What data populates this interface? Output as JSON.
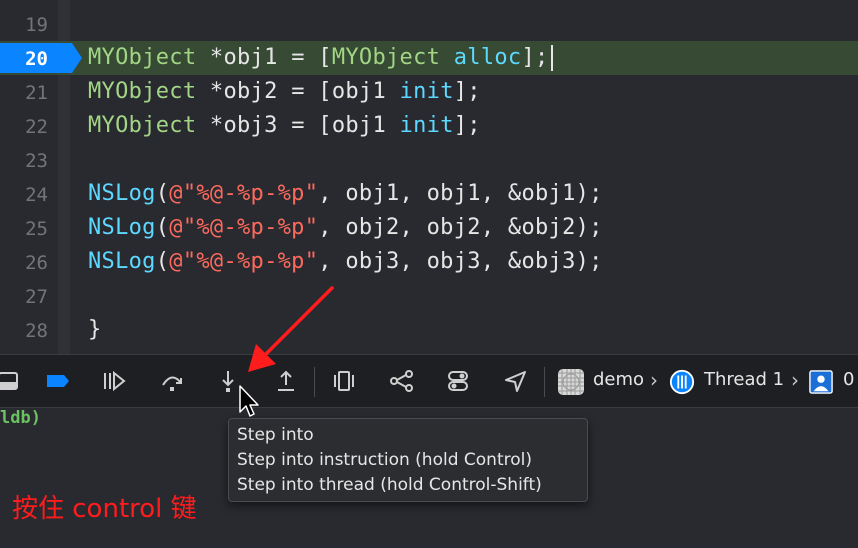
{
  "editor": {
    "lines": [
      {
        "num": "19",
        "tokens": []
      },
      {
        "num": "20",
        "current": true,
        "tokens": [
          {
            "cls": "t-type",
            "text": "MYObject"
          },
          {
            "cls": "t-plain",
            "text": " *obj1 = ["
          },
          {
            "cls": "t-type",
            "text": "MYObject"
          },
          {
            "cls": "t-plain",
            "text": " "
          },
          {
            "cls": "t-msg",
            "text": "alloc"
          },
          {
            "cls": "t-plain",
            "text": "];"
          }
        ]
      },
      {
        "num": "21",
        "tokens": [
          {
            "cls": "t-type",
            "text": "MYObject"
          },
          {
            "cls": "t-plain",
            "text": " *obj2 = [obj1 "
          },
          {
            "cls": "t-msg",
            "text": "init"
          },
          {
            "cls": "t-plain",
            "text": "];"
          }
        ]
      },
      {
        "num": "22",
        "tokens": [
          {
            "cls": "t-type",
            "text": "MYObject"
          },
          {
            "cls": "t-plain",
            "text": " *obj3 = [obj1 "
          },
          {
            "cls": "t-msg",
            "text": "init"
          },
          {
            "cls": "t-plain",
            "text": "];"
          }
        ]
      },
      {
        "num": "23",
        "tokens": []
      },
      {
        "num": "24",
        "tokens": [
          {
            "cls": "t-msg",
            "text": "NSLog"
          },
          {
            "cls": "t-plain",
            "text": "("
          },
          {
            "cls": "t-str",
            "text": "@\"%@-%p-%p\""
          },
          {
            "cls": "t-plain",
            "text": ", obj1, obj1, &obj1);"
          }
        ]
      },
      {
        "num": "25",
        "tokens": [
          {
            "cls": "t-msg",
            "text": "NSLog"
          },
          {
            "cls": "t-plain",
            "text": "("
          },
          {
            "cls": "t-str",
            "text": "@\"%@-%p-%p\""
          },
          {
            "cls": "t-plain",
            "text": ", obj2, obj2, &obj2);"
          }
        ]
      },
      {
        "num": "26",
        "tokens": [
          {
            "cls": "t-msg",
            "text": "NSLog"
          },
          {
            "cls": "t-plain",
            "text": "("
          },
          {
            "cls": "t-str",
            "text": "@\"%@-%p-%p\""
          },
          {
            "cls": "t-plain",
            "text": ", obj3, obj3, &obj3);"
          }
        ]
      },
      {
        "num": "27",
        "tokens": []
      },
      {
        "num": "28",
        "tokens": [
          {
            "cls": "t-plain",
            "text": "}"
          }
        ]
      }
    ]
  },
  "debugbar": {
    "buttons": [
      {
        "name": "hide-debug-area-icon"
      },
      {
        "name": "breakpoints-toggle-icon"
      },
      {
        "name": "continue-icon"
      },
      {
        "name": "step-over-icon"
      },
      {
        "name": "step-into-icon"
      },
      {
        "name": "step-out-icon"
      },
      {
        "name": "debug-view-hierarchy-icon"
      },
      {
        "name": "debug-memory-graph-icon"
      },
      {
        "name": "environment-overrides-icon"
      },
      {
        "name": "simulate-location-icon"
      }
    ],
    "breadcrumbs": {
      "app": "demo",
      "thread": "Thread 1",
      "frame": "0"
    }
  },
  "console": {
    "prompt": "ldb)"
  },
  "tooltip": {
    "lines": [
      "Step into",
      "Step into instruction (hold Control)",
      "Step into thread (hold Control-Shift)"
    ]
  },
  "annotation": {
    "text": "按住 control 键"
  },
  "colors": {
    "accent": "#0a84ff",
    "annotation": "#ff1c1c",
    "current_line": "#364a34"
  }
}
